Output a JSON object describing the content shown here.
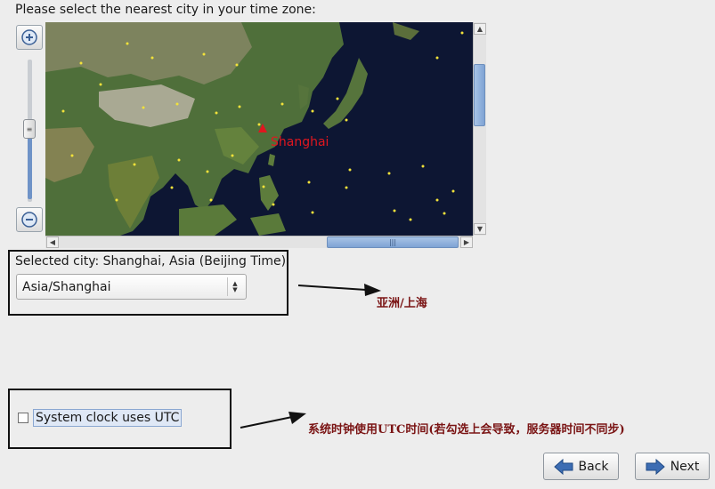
{
  "prompt": "Please select the nearest city in your time zone:",
  "map": {
    "city_label": "Shanghai",
    "marker_color": "#e0161f"
  },
  "selected_city": "Selected city: Shanghai, Asia (Beijing Time)",
  "timezone_select": {
    "value": "Asia/Shanghai"
  },
  "utc_checkbox": {
    "label": "System clock uses UTC",
    "checked": false
  },
  "annotations": {
    "city_note": "亚洲/上海",
    "utc_note": "系统时钟使用UTC时间(若勾选上会导致，服务器时间不同步)",
    "color": "#7a1414"
  },
  "buttons": {
    "back": "Back",
    "next": "Next"
  },
  "icons": {
    "zoom_in": "zoom-in-icon",
    "zoom_out": "zoom-out-icon",
    "back": "arrow-left-icon",
    "next": "arrow-right-icon"
  }
}
